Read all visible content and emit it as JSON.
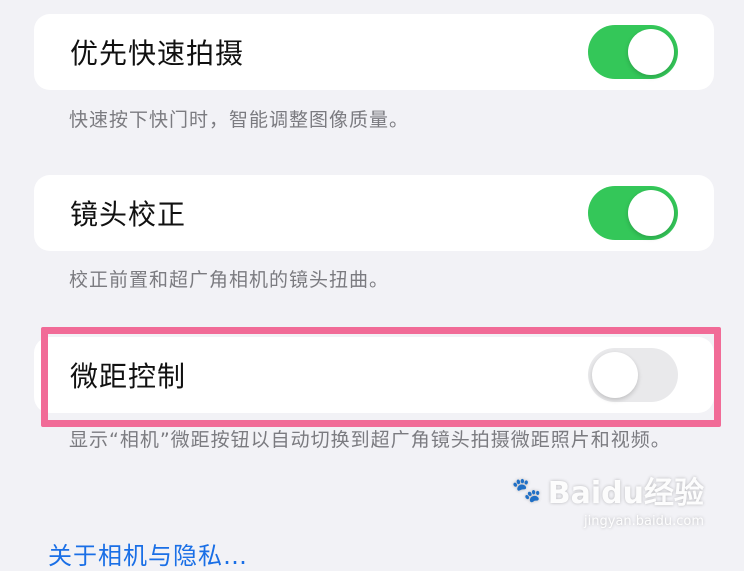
{
  "settings": [
    {
      "label": "优先快速拍摄",
      "state": "on",
      "footnote": "快速按下快门时，智能调整图像质量。"
    },
    {
      "label": "镜头校正",
      "state": "on",
      "footnote": "校正前置和超广角相机的镜头扭曲。"
    },
    {
      "label": "微距控制",
      "state": "off",
      "footnote": "显示“相机”微距按钮以自动切换到超广角镜头拍摄微距照片和视频。"
    }
  ],
  "link": {
    "label": "关于相机与隐私…"
  },
  "watermark": {
    "brand": "Baidu经验",
    "url": "jingyan.baidu.com"
  },
  "colors": {
    "toggle_on": "#34c759",
    "toggle_off": "#e9e9eb",
    "highlight_border": "#f16b97",
    "link": "#1a6fe6",
    "background": "#f2f2f6"
  },
  "icons": {
    "watermark": "paw-icon"
  }
}
